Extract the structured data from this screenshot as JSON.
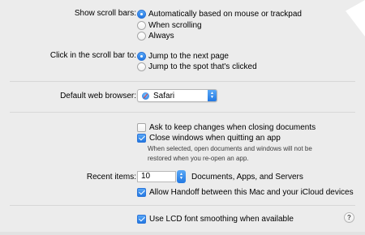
{
  "scroll_bars": {
    "label": "Show scroll bars:",
    "options": [
      {
        "label": "Automatically based on mouse or trackpad",
        "selected": true
      },
      {
        "label": "When scrolling",
        "selected": false
      },
      {
        "label": "Always",
        "selected": false
      }
    ]
  },
  "scroll_click": {
    "label": "Click in the scroll bar to:",
    "options": [
      {
        "label": "Jump to the next page",
        "selected": true
      },
      {
        "label": "Jump to the spot that's clicked",
        "selected": false
      }
    ]
  },
  "browser": {
    "label": "Default web browser:",
    "value": "Safari"
  },
  "documents": {
    "ask_keep_changes": {
      "label": "Ask to keep changes when closing documents",
      "checked": false
    },
    "close_windows": {
      "label": "Close windows when quitting an app",
      "checked": true
    },
    "note_line1": "When selected, open documents and windows will not be",
    "note_line2": "restored when you re-open an app."
  },
  "recent": {
    "label": "Recent items:",
    "value": "10",
    "suffix": "Documents, Apps, and Servers"
  },
  "handoff": {
    "label": "Allow Handoff between this Mac and your iCloud devices",
    "checked": true
  },
  "lcd": {
    "label": "Use LCD font smoothing when available",
    "checked": true
  },
  "help": {
    "label": "?"
  },
  "colors": {
    "accent": "#2b7be6",
    "background": "#ececec"
  }
}
